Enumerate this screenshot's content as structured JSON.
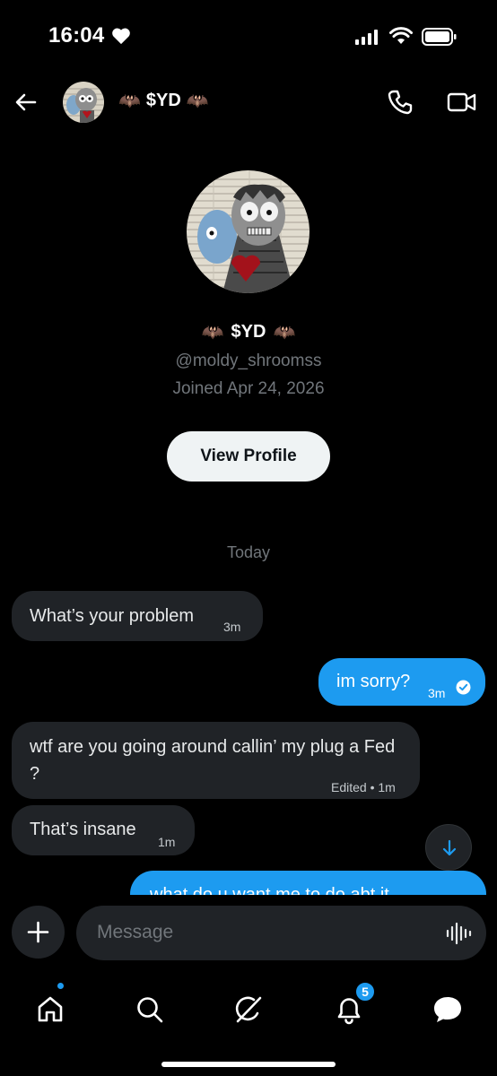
{
  "status_bar": {
    "time": "16:04",
    "heart_icon": "heart-icon",
    "signal_icon": "cellular-signal-icon",
    "wifi_icon": "wifi-icon",
    "battery_icon": "battery-icon"
  },
  "header": {
    "back_icon": "arrow-left-icon",
    "name_emoji_left": "🦇",
    "name": "$YD",
    "name_emoji_right": "🦇",
    "call_icon": "phone-icon",
    "video_icon": "video-camera-icon"
  },
  "profile": {
    "emoji_left": "🦇",
    "name": "$YD",
    "emoji_right": "🦇",
    "handle": "@moldy_shroomss",
    "joined": "Joined Apr 24, 2026",
    "view_profile_label": "View Profile"
  },
  "day_separator": "Today",
  "messages": [
    {
      "direction": "received",
      "text": "What’s your problem",
      "time": "3m"
    },
    {
      "direction": "sent",
      "text": "im sorry?",
      "time": "3m",
      "status_icon": "check-circle-icon"
    },
    {
      "direction": "received",
      "text": "wtf are you going around callin’ my plug a Fed ?",
      "time": "Edited • 1m"
    },
    {
      "direction": "received",
      "text": "That’s insane",
      "time": "1m"
    },
    {
      "direction": "sent",
      "text": "what do u want me to do abt it",
      "time": ""
    }
  ],
  "scroll_down_icon": "arrow-down-icon",
  "composer": {
    "add_icon": "plus-icon",
    "placeholder": "Message",
    "voice_icon": "voice-waveform-icon"
  },
  "bottom_nav": {
    "items": [
      {
        "name": "home",
        "icon": "home-icon"
      },
      {
        "name": "search",
        "icon": "search-icon"
      },
      {
        "name": "grok",
        "icon": "grok-icon"
      },
      {
        "name": "notifications",
        "icon": "bell-icon",
        "badge": "5"
      },
      {
        "name": "messages",
        "icon": "chat-bubble-icon"
      }
    ]
  },
  "colors": {
    "background": "#000000",
    "accent": "#1d9bf0",
    "bubble_received": "#202327",
    "muted_text": "#71767b"
  }
}
